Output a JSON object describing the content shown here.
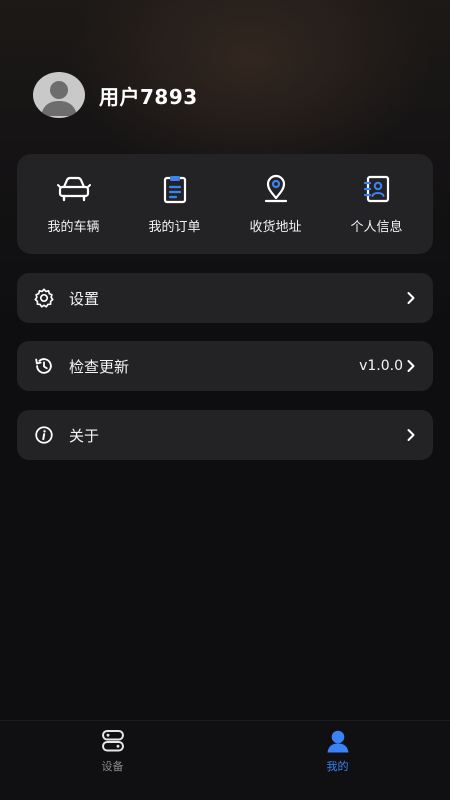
{
  "profile": {
    "username": "用户7893",
    "avatar_icon": "user-avatar-icon"
  },
  "quick_actions": [
    {
      "label": "我的车辆",
      "icon": "car-icon"
    },
    {
      "label": "我的订单",
      "icon": "clipboard-icon"
    },
    {
      "label": "收货地址",
      "icon": "location-pin-icon"
    },
    {
      "label": "个人信息",
      "icon": "contact-card-icon"
    }
  ],
  "menu": {
    "settings": {
      "label": "设置",
      "icon": "gear-icon"
    },
    "update": {
      "label": "检查更新",
      "icon": "history-icon",
      "value": "v1.0.0"
    },
    "about": {
      "label": "关于",
      "icon": "info-icon"
    }
  },
  "tabbar": {
    "tabs": [
      {
        "label": "设备",
        "icon": "devices-icon",
        "active": false
      },
      {
        "label": "我的",
        "icon": "person-icon",
        "active": true
      }
    ]
  },
  "colors": {
    "accent": "#3b82f6",
    "card": "#232326",
    "background": "#0e0e10",
    "inactive_tab": "#8a8a8e"
  }
}
